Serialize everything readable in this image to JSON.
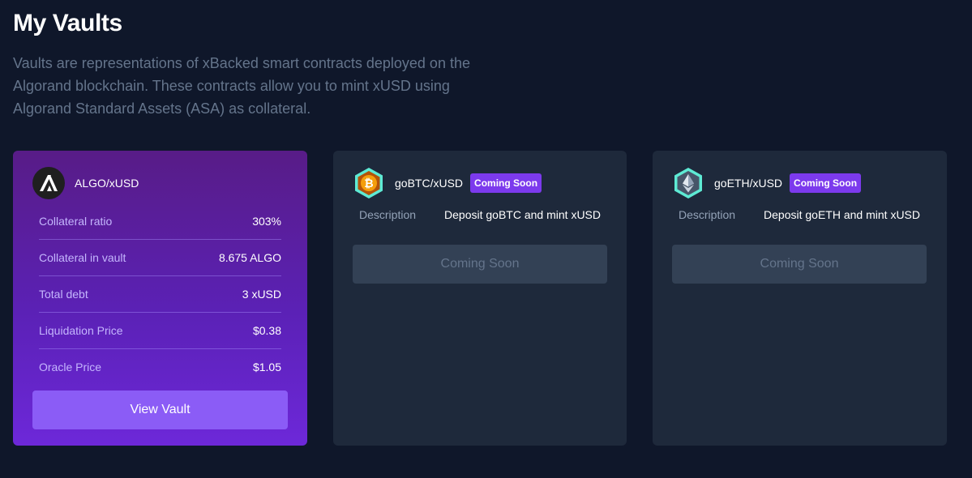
{
  "page": {
    "title": "My Vaults",
    "description": "Vaults are representations of xBacked smart contracts deployed on the Algorand blockchain. These contracts allow you to mint xUSD using Algorand Standard Assets (ASA) as collateral."
  },
  "vaults": [
    {
      "pair": "ALGO/xUSD",
      "icon": "algorand-logo-icon",
      "stats": [
        {
          "label": "Collateral ratio",
          "value": "303%"
        },
        {
          "label": "Collateral in vault",
          "value": "8.675 ALGO"
        },
        {
          "label": "Total debt",
          "value": "3 xUSD"
        },
        {
          "label": "Liquidation Price",
          "value": "$0.38"
        },
        {
          "label": "Oracle Price",
          "value": "$1.05"
        }
      ],
      "button_label": "View Vault"
    },
    {
      "pair": "goBTC/xUSD",
      "icon": "bitcoin-icon",
      "badge": "Coming Soon",
      "description_label": "Description",
      "description_value": "Deposit goBTC and mint xUSD",
      "button_label": "Coming Soon"
    },
    {
      "pair": "goETH/xUSD",
      "icon": "ethereum-icon",
      "badge": "Coming Soon",
      "description_label": "Description",
      "description_value": "Deposit goETH and mint xUSD",
      "button_label": "Coming Soon"
    }
  ],
  "colors": {
    "background": "#0f172a",
    "card": "#1e293b",
    "accent": "#7c3aed",
    "button_primary": "#8b5cf6",
    "button_disabled": "#334155"
  }
}
